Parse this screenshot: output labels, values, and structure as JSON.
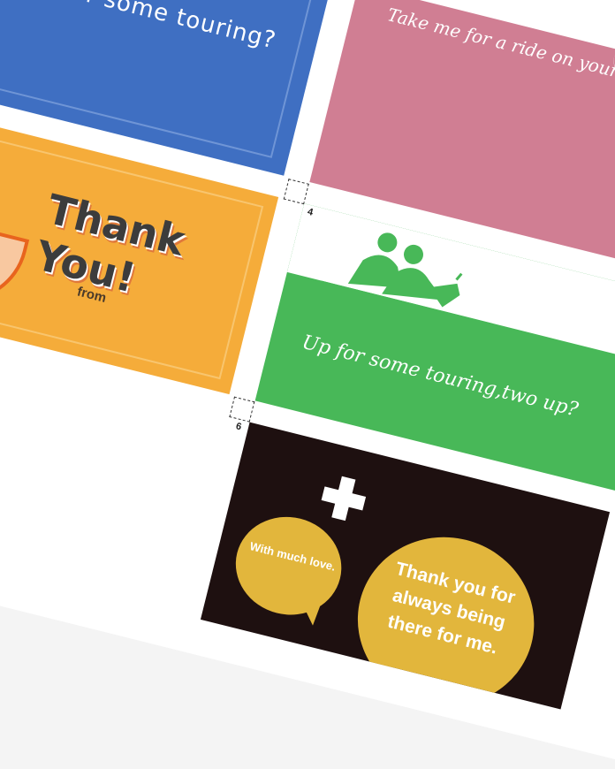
{
  "cards": {
    "blue": {
      "message": "Up for some touring?"
    },
    "pink": {
      "message": "Take me for a ride on your b"
    },
    "orange": {
      "title": "Thank You!",
      "from_label": "from"
    },
    "green": {
      "number": "4",
      "message": "Up for some touring,two up?"
    },
    "black": {
      "number": "6",
      "small_bubble": "With much love.",
      "large_bubble": "Thank you for always being there for me."
    }
  },
  "colors": {
    "blue": "#3f6fc2",
    "pink": "#d07e93",
    "orange": "#f5ac3a",
    "green": "#48b858",
    "black": "#1e1010",
    "bubble": "#e2b63c"
  }
}
